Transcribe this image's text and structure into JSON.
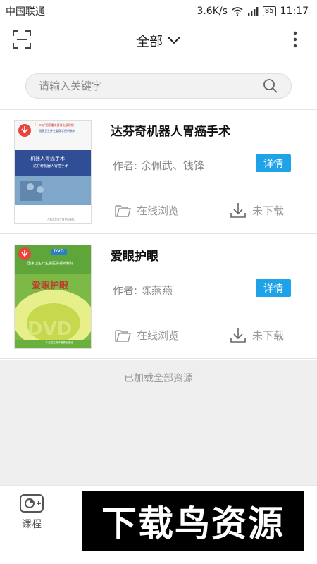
{
  "status_bar": {
    "carrier": "中国联通",
    "speed": "3.6K/s",
    "battery": "85",
    "time": "11:17"
  },
  "header": {
    "title": "全部",
    "scan_icon": "scan-icon",
    "more_icon": "more-vertical-icon"
  },
  "search": {
    "placeholder": "请输入关键字"
  },
  "list": [
    {
      "title": "达芬奇机器人胃癌手术",
      "author": "作者: 余佩武、钱锋",
      "detail_label": "详情",
      "browse_label": "在线浏览",
      "download_label": "未下载",
      "cover": {
        "series": "\"十二五\"国家重点音像出版规划",
        "series2": "国家卫生计生委医学视听教材",
        "title": "机器人胃癌手术",
        "subtitle": "——达芬奇机器人胃癌手术",
        "publisher": "人民卫生电子音像出版社"
      }
    },
    {
      "title": "爱眼护眼",
      "author": "作者: 陈燕燕",
      "detail_label": "详情",
      "browse_label": "在线浏览",
      "download_label": "未下载",
      "cover": {
        "series": "DVD",
        "series2": "国家卫生计生委医学视听教材",
        "title": "爱眼护眼",
        "dvd": "DVD",
        "publisher": "人民卫生电子音像出版社"
      }
    }
  ],
  "footer_text": "已加载全部资源",
  "bottom_nav": {
    "course_label": "课程"
  },
  "watermark": {
    "text": "下载鸟资源"
  },
  "colors": {
    "accent": "#1fa3e8",
    "gray_bg": "#efefef"
  }
}
